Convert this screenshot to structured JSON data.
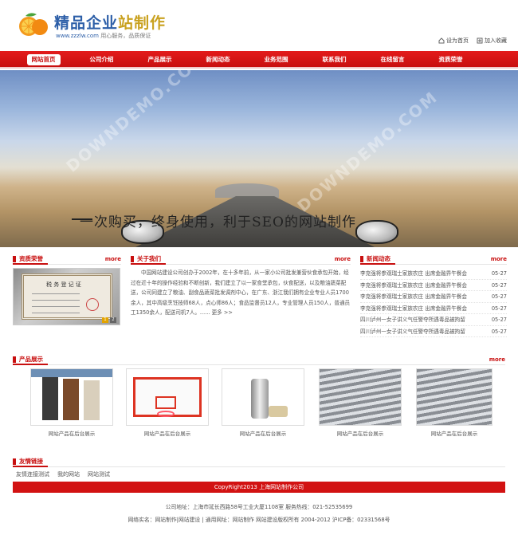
{
  "header": {
    "title_part1": "精品企业",
    "title_part2": "站制作",
    "url": "www.zzzlw.com",
    "slogan": "用心服务，品质保证",
    "set_home": "设为首页",
    "add_favorite": "加入收藏"
  },
  "nav": {
    "items": [
      "网站首页",
      "公司介绍",
      "产品展示",
      "新闻动态",
      "业务范围",
      "联系我们",
      "在线留言",
      "资质荣誉"
    ]
  },
  "banner": {
    "headline": "一次购买，终身使用，利于SEO的网站制作",
    "watermark": "DOWNDEMO.COM"
  },
  "sections": {
    "qualification": {
      "title": "资质荣誉",
      "more": "more"
    },
    "about": {
      "title": "关于我们",
      "more": "more"
    },
    "news": {
      "title": "新闻动态",
      "more": "more"
    },
    "products": {
      "title": "产品展示",
      "more": "more"
    },
    "links": {
      "title": "友情链接"
    }
  },
  "cert": {
    "heading": "税 务 登 记 证",
    "pages": [
      "1",
      "2"
    ]
  },
  "about_text": "中国网站建设公司创办于2002年，在十多年前，从一家小公司批发兼营伙食承包开始，经过在近十年的操作经验和不断创新，我们建立了以一家食堂承包，伙食配送，以及粮油蔬菜配送，公司同建立了粮油、副食品蔬菜批发调剂中心，在广东、浙江我们拥有企业专业人员1700余人，其中高级烹饪技师68人，点心师86人；食品监督员12人，专业管理人员150人，普通员工1350余人，配送司机7人。......  更多 >>",
  "news": [
    {
      "title": "李克强将参观瑞士家族农庄 出席金融界午餐会",
      "date": "05-27"
    },
    {
      "title": "李克强将参观瑞士家族农庄 出席金融界午餐会",
      "date": "05-27"
    },
    {
      "title": "李克强将参观瑞士家族农庄 出席金融界午餐会",
      "date": "05-27"
    },
    {
      "title": "李克强将参观瑞士家族农庄 出席金融界午餐会",
      "date": "05-27"
    },
    {
      "title": "四川泸州一女子讲义气任警夺所遇毒品被拘留",
      "date": "05-27"
    },
    {
      "title": "四川泸州一女子讲义气任警夺所遇毒品被拘留",
      "date": "05-27"
    }
  ],
  "products": [
    {
      "caption": "网站产品在后台展示"
    },
    {
      "caption": "网站产品在后台展示"
    },
    {
      "caption": "网站产品在后台展示"
    },
    {
      "caption": "网站产品在后台展示"
    },
    {
      "caption": "网站产品在后台展示"
    }
  ],
  "links": [
    "友情连接测试",
    "我的网站",
    "网站测试"
  ],
  "footer": {
    "copyright": "CopyRight2013 上海网站制作公司",
    "address": "公司地址：上海市延长西路58号工业大厦1108室 服务热线：021-52535699",
    "info": "网络实名：网站制作|网站建设 | 通用网址：网站制作 网站建设版权所有 2004-2012 沪ICP备：02331568号"
  },
  "colors": {
    "brand_red": "#c80f0f",
    "title_gold": "#c9a11f",
    "title_blue": "#2d5fa8"
  }
}
